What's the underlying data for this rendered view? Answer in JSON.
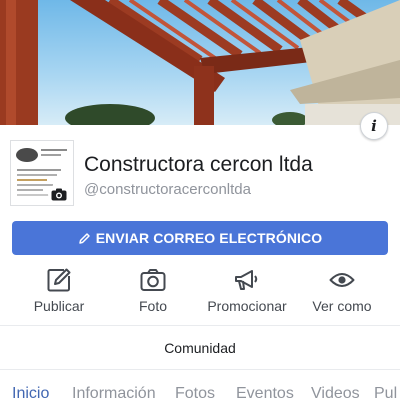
{
  "cover": {
    "info_icon": "info-icon",
    "info_glyph": "i"
  },
  "profile": {
    "name": "Constructora cercon ltda",
    "handle": "@constructoracerconltda",
    "camera_icon": "camera-icon"
  },
  "primary_action": {
    "label": "ENVIAR CORREO ELECTRÓNICO",
    "icon": "pencil-icon",
    "color": "#4a75d8"
  },
  "actions": [
    {
      "label": "Publicar",
      "icon": "edit-icon"
    },
    {
      "label": "Foto",
      "icon": "camera-icon"
    },
    {
      "label": "Promocionar",
      "icon": "megaphone-icon"
    },
    {
      "label": "Ver como",
      "icon": "eye-icon"
    }
  ],
  "community": {
    "label": "Comunidad"
  },
  "tabs": [
    {
      "label": "Inicio",
      "active": true
    },
    {
      "label": "Información",
      "active": false
    },
    {
      "label": "Fotos",
      "active": false
    },
    {
      "label": "Eventos",
      "active": false
    },
    {
      "label": "Videos",
      "active": false
    },
    {
      "label": "Pul",
      "active": false
    }
  ],
  "colors": {
    "accent": "#4267b2",
    "text_secondary": "#90949c"
  }
}
